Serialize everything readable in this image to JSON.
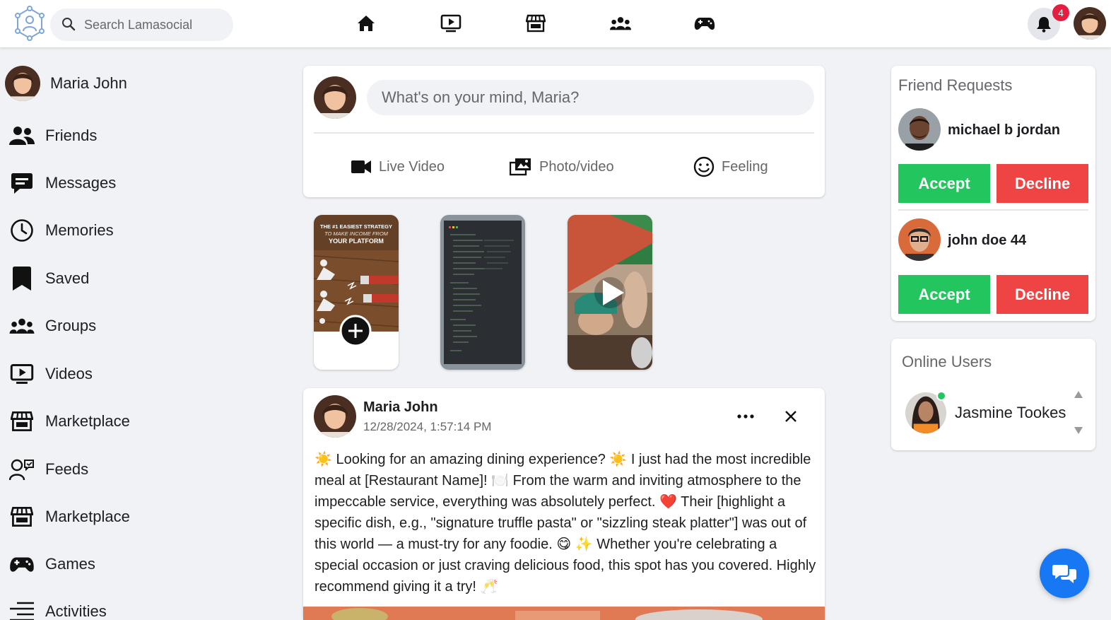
{
  "app": {
    "search": {
      "placeholder": "Search Lamasocial",
      "icon": "search-icon"
    },
    "nav_icons": [
      "home-icon",
      "video-icon",
      "marketplace-icon",
      "groups-icon",
      "games-icon"
    ],
    "notifications": {
      "count": "4",
      "icon": "bell-icon"
    },
    "colors": {
      "accent": "#1877f2",
      "accept": "#22c55e",
      "decline": "#ef4444",
      "badge": "#e41e3f",
      "online": "#22c55e"
    }
  },
  "sidebar": {
    "profile_name": "Maria John",
    "items": [
      {
        "label": "Friends",
        "icon": "friends-icon"
      },
      {
        "label": "Messages",
        "icon": "messages-icon"
      },
      {
        "label": "Memories",
        "icon": "clock-icon"
      },
      {
        "label": "Saved",
        "icon": "bookmark-icon"
      },
      {
        "label": "Groups",
        "icon": "groups-icon"
      },
      {
        "label": "Videos",
        "icon": "video-icon"
      },
      {
        "label": "Marketplace",
        "icon": "marketplace-icon"
      },
      {
        "label": "Feeds",
        "icon": "feeds-icon"
      },
      {
        "label": "Marketplace",
        "icon": "marketplace-icon"
      },
      {
        "label": "Games",
        "icon": "games-icon"
      },
      {
        "label": "Activities",
        "icon": "activities-icon"
      }
    ]
  },
  "composer": {
    "placeholder": "What's on your mind, Maria?",
    "actions": [
      {
        "label": "Live Video",
        "icon": "live-video-icon"
      },
      {
        "label": "Photo/video",
        "icon": "photo-video-icon"
      },
      {
        "label": "Feeling",
        "icon": "smile-icon"
      }
    ]
  },
  "stories": {
    "first_story_text": [
      "THE #1 EASIEST STRATEGY",
      "TO MAKE INCOME FROM",
      "YOUR PLATFORM"
    ]
  },
  "post": {
    "author": "Maria John",
    "timestamp": "12/28/2024, 1:57:14 PM",
    "text": "☀️ Looking for an amazing dining experience? ☀️ I just had the most incredible meal at [Restaurant Name]! 🍽️ From the warm and inviting atmosphere to the impeccable service, everything was absolutely perfect. ❤️ Their [highlight a specific dish, e.g., \"signature truffle pasta\" or \"sizzling steak platter\"] was out of this world — a must-try for any foodie. 😋 ✨ Whether you're celebrating a special occasion or just craving delicious food, this spot has you covered. Highly recommend giving it a try! 🥂"
  },
  "friend_requests": {
    "title": "Friend Requests",
    "requests": [
      {
        "name": "michael b jordan",
        "accept": "Accept",
        "decline": "Decline"
      },
      {
        "name": "john doe 44",
        "accept": "Accept",
        "decline": "Decline"
      }
    ]
  },
  "online_users": {
    "title": "Online Users",
    "users": [
      {
        "name": "Jasmine Tookes"
      }
    ]
  }
}
